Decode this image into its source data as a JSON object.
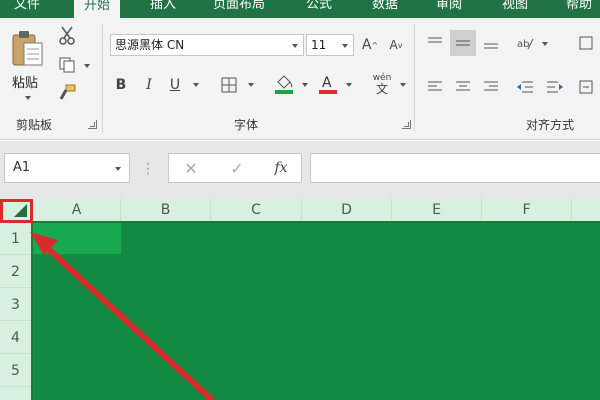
{
  "app": {
    "accent": "#217346",
    "grid_fill": "#128a44",
    "annotation_color": "#d92b2b"
  },
  "tabs": [
    "文件",
    "开始",
    "插入",
    "页面布局",
    "公式",
    "数据",
    "审阅",
    "视图",
    "帮助"
  ],
  "clipboard": {
    "paste_label": "粘贴",
    "group_label": "剪贴板"
  },
  "font": {
    "name": "思源黑体 CN",
    "size": "11",
    "group_label": "字体",
    "phonetic": "wén"
  },
  "alignment": {
    "group_label": "对齐方式"
  },
  "formula_bar": {
    "name_box": "A1",
    "fx": "fx"
  },
  "grid": {
    "columns": [
      "A",
      "B",
      "C",
      "D",
      "E",
      "F"
    ],
    "rows": [
      "1",
      "2",
      "3",
      "4",
      "5"
    ]
  }
}
